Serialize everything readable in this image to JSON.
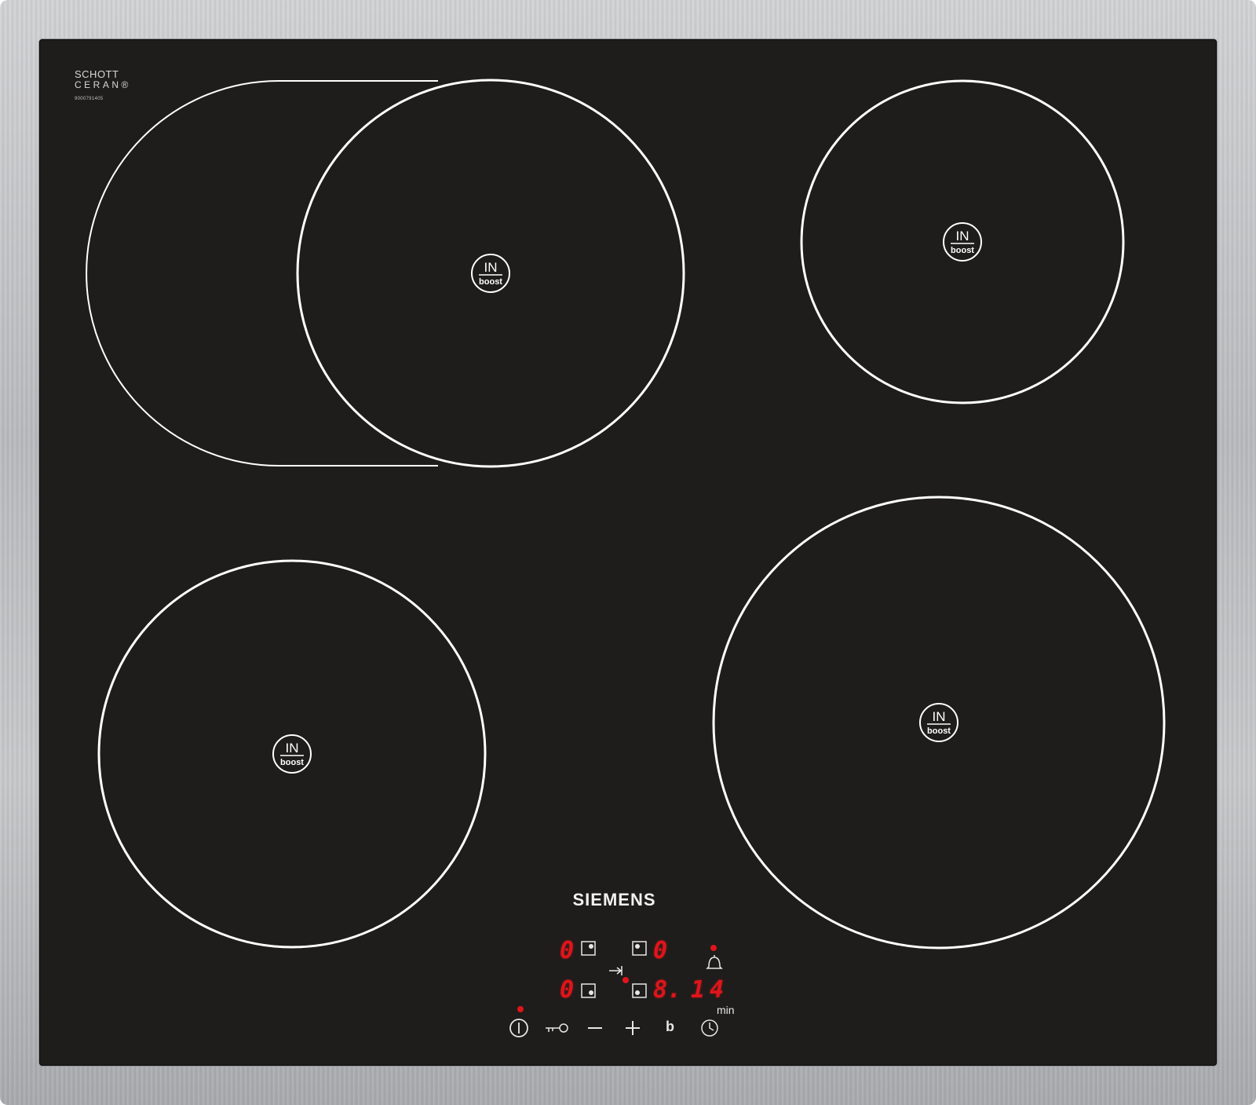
{
  "brand": "SIEMENS",
  "glass_logo": {
    "line1": "SCHOTT",
    "line2": "CERAN®",
    "code": "9000791405"
  },
  "zone_badge": {
    "top": "IN",
    "bottom": "boost"
  },
  "display": {
    "front_left": "0",
    "rear_left": "0",
    "rear_right": "0",
    "front_right": "8.",
    "timer": "14",
    "timer_unit": "min"
  },
  "controls": {
    "power_icon": "power-icon",
    "lock_icon": "key-lock-icon",
    "minus_icon": "minus-icon",
    "plus_icon": "plus-icon",
    "boost_label": "b",
    "timer_icon": "clock-icon",
    "bell_icon": "bell-icon",
    "select_arrow_icon": "arrow-to-bar-icon"
  },
  "colors": {
    "glass": "#1e1d1b",
    "frame": "#c4c5c7",
    "ring": "#ffffff",
    "led": "#e0141b"
  }
}
